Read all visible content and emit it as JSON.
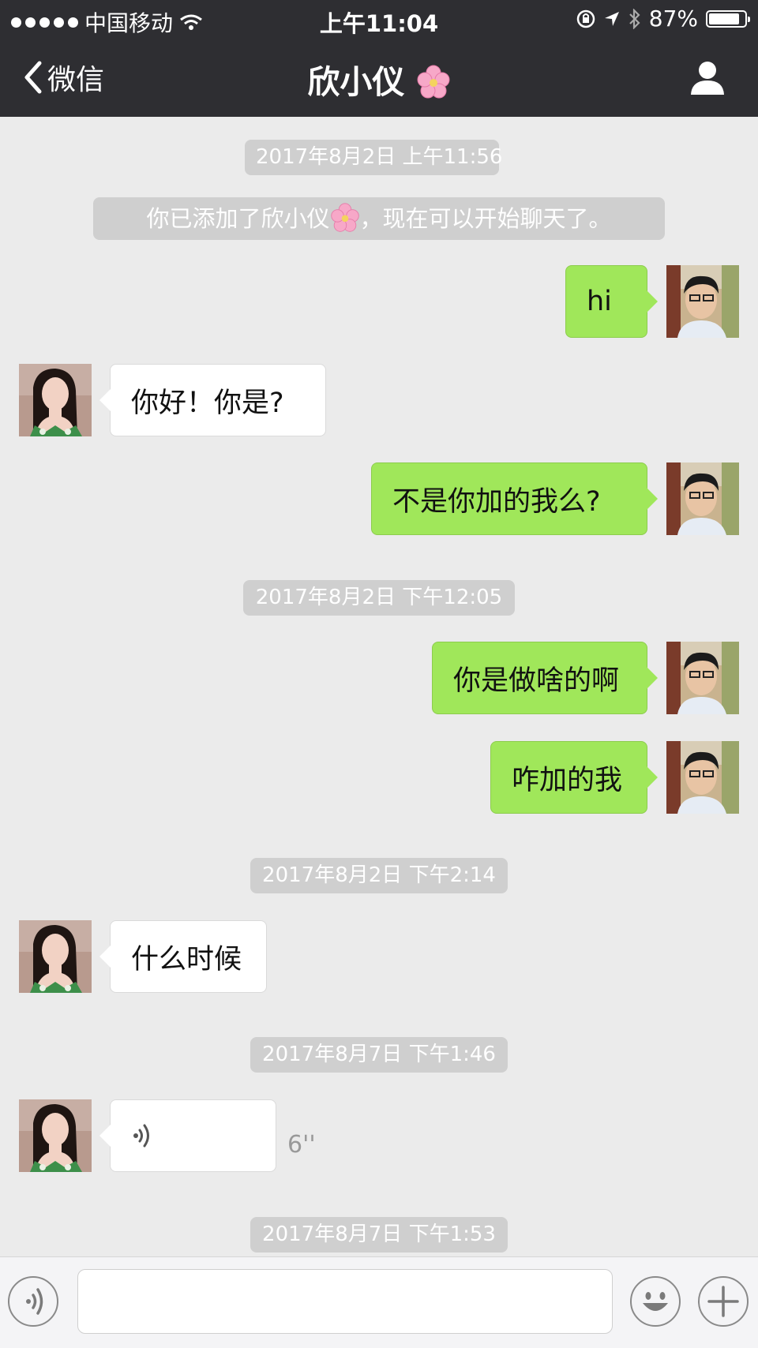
{
  "status_bar": {
    "carrier": "中国移动",
    "time": "上午11:04",
    "battery": "87%",
    "battery_level": 0.87,
    "icons": [
      "signal-dots-icon",
      "wifi-icon",
      "orientation-lock-icon",
      "location-arrow-icon",
      "bluetooth-icon",
      "battery-icon"
    ]
  },
  "nav": {
    "back_label": "微信",
    "title": "欣小仪",
    "title_emoji": "cherry-blossom-icon",
    "right_icon": "profile-icon"
  },
  "chat": {
    "timestamps": [
      "2017年8月2日 上午11:56",
      "2017年8月2日 下午12:05",
      "2017年8月2日 下午2:14",
      "2017年8月7日 下午1:46",
      "2017年8月7日 下午1:53"
    ],
    "system_message": {
      "before": "你已添加了欣小仪",
      "after": "，现在可以开始聊天了。"
    },
    "messages": [
      {
        "sender": "me",
        "text": "hi"
      },
      {
        "sender": "them",
        "text": "你好！你是?"
      },
      {
        "sender": "me",
        "text": "不是你加的我么?"
      },
      {
        "sender": "me",
        "text": "你是做啥的啊"
      },
      {
        "sender": "me",
        "text": "咋加的我"
      },
      {
        "sender": "them",
        "text": "什么时候"
      },
      {
        "sender": "them",
        "type": "voice",
        "duration": "6''"
      }
    ]
  },
  "input_bar": {
    "voice_icon": "voice-icon",
    "placeholder": "",
    "emoji_icon": "emoji-icon",
    "plus_icon": "plus-icon"
  },
  "colors": {
    "nav_bg": "#2e2e32",
    "chat_bg": "#ebebeb",
    "my_bubble": "#a0e75a",
    "their_bubble": "#ffffff",
    "timestamp_bg": "#cfcfcf"
  }
}
